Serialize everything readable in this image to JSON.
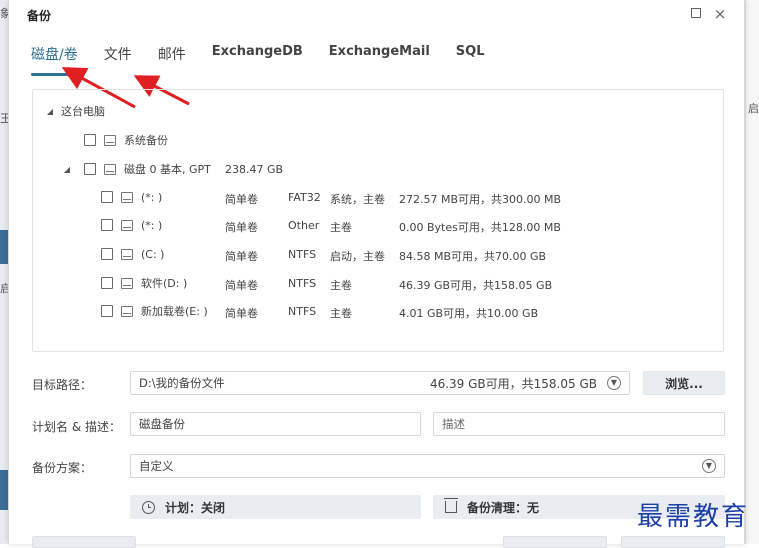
{
  "background_app": {
    "left_fragment_1": "象",
    "left_fragment_2": "王",
    "left_fragment_3": "启",
    "right_fragment": "启"
  },
  "dialog": {
    "title": "备份",
    "maximize_label": "",
    "close_label": "×"
  },
  "tabs": [
    {
      "label": "磁盘/卷",
      "active": true
    },
    {
      "label": "文件",
      "active": false
    },
    {
      "label": "邮件",
      "active": false
    },
    {
      "label": "ExchangeDB",
      "active": false
    },
    {
      "label": "ExchangeMail",
      "active": false
    },
    {
      "label": "SQL",
      "active": false
    }
  ],
  "tree": {
    "root": {
      "label": "这台电脑"
    },
    "system_backup": {
      "label": "系统备份"
    },
    "disk0": {
      "label": "磁盘 0 基本, GPT",
      "size": "238.47 GB"
    },
    "partitions": [
      {
        "name": "(*: )",
        "type": "简单卷",
        "fs": "FAT32",
        "flags": "系统，主卷",
        "space": "272.57 MB可用，共300.00 MB"
      },
      {
        "name": "(*: )",
        "type": "简单卷",
        "fs": "Other",
        "flags": "主卷",
        "space": "0.00 Bytes可用，共128.00 MB"
      },
      {
        "name": "(C: )",
        "type": "简单卷",
        "fs": "NTFS",
        "flags": "启动，主卷",
        "space": "84.58 MB可用，共70.00 GB"
      },
      {
        "name": "软件(D: )",
        "type": "简单卷",
        "fs": "NTFS",
        "flags": "主卷",
        "space": "46.39 GB可用，共158.05 GB"
      },
      {
        "name": "新加载卷(E: )",
        "type": "简单卷",
        "fs": "NTFS",
        "flags": "主卷",
        "space": "4.01 GB可用，共10.00 GB"
      }
    ]
  },
  "form": {
    "target_path_label": "目标路径：",
    "target_path_value": "D:\\我的备份文件",
    "target_space": "46.39 GB可用，共158.05 GB",
    "browse_label": "浏览...",
    "plan_label": "计划名 & 描述：",
    "plan_name": "磁盘备份",
    "description_placeholder": "描述",
    "scheme_label": "备份方案：",
    "scheme_value": "自定义",
    "schedule_label": "计划：关闭",
    "cleanup_label": "备份清理：无"
  },
  "watermark": "最需教育",
  "colors": {
    "accent": "#2f6f8f",
    "arrow": "#e02020",
    "watermark": "#1c3fa8"
  }
}
